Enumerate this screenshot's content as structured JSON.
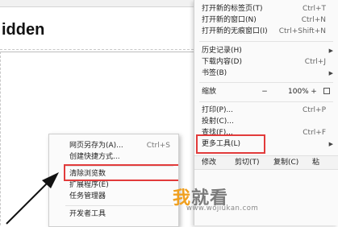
{
  "page": {
    "heading": "idden"
  },
  "main_menu": {
    "items": [
      {
        "label": "打开新的标签页(T)",
        "shortcut": "Ctrl+T"
      },
      {
        "label": "打开新的窗口(N)",
        "shortcut": "Ctrl+N"
      },
      {
        "label": "打开新的无痕窗口(I)",
        "shortcut": "Ctrl+Shift+N"
      },
      {
        "label": "历史记录(H)",
        "shortcut": ""
      },
      {
        "label": "下载内容(D)",
        "shortcut": "Ctrl+J"
      },
      {
        "label": "书签(B)",
        "shortcut": ""
      },
      {
        "label": "打印(P)...",
        "shortcut": "Ctrl+P"
      },
      {
        "label": "投射(C)...",
        "shortcut": ""
      },
      {
        "label": "查找(F)...",
        "shortcut": "Ctrl+F"
      },
      {
        "label": "更多工具(L)",
        "shortcut": ""
      }
    ],
    "zoom": {
      "label": "缩放",
      "minus": "−",
      "value": "100%",
      "plus": "+"
    },
    "edit": {
      "label": "修改",
      "cut": "剪切(T)",
      "copy": "复制(C)",
      "paste": "粘"
    }
  },
  "sub_menu": {
    "items": [
      {
        "label": "网页另存为(A)...",
        "shortcut": "Ctrl+S"
      },
      {
        "label": "创建快捷方式...",
        "shortcut": ""
      },
      {
        "label": "清除浏览数",
        "shortcut": ""
      },
      {
        "label": "扩展程序(E)",
        "shortcut": ""
      },
      {
        "label": "任务管理器",
        "shortcut": ""
      },
      {
        "label": "开发者工具",
        "shortcut": ""
      }
    ]
  },
  "watermark": {
    "char1": "我",
    "char2": "就看",
    "url": "www.wojiukan.com"
  },
  "colors": {
    "highlight": "#e23b3b",
    "watermark_accent": "#f0a020"
  },
  "icons": {
    "submenu_arrow": "chevron-right-icon",
    "fullscreen": "fullscreen-icon",
    "pointer": "arrow-pointer"
  }
}
